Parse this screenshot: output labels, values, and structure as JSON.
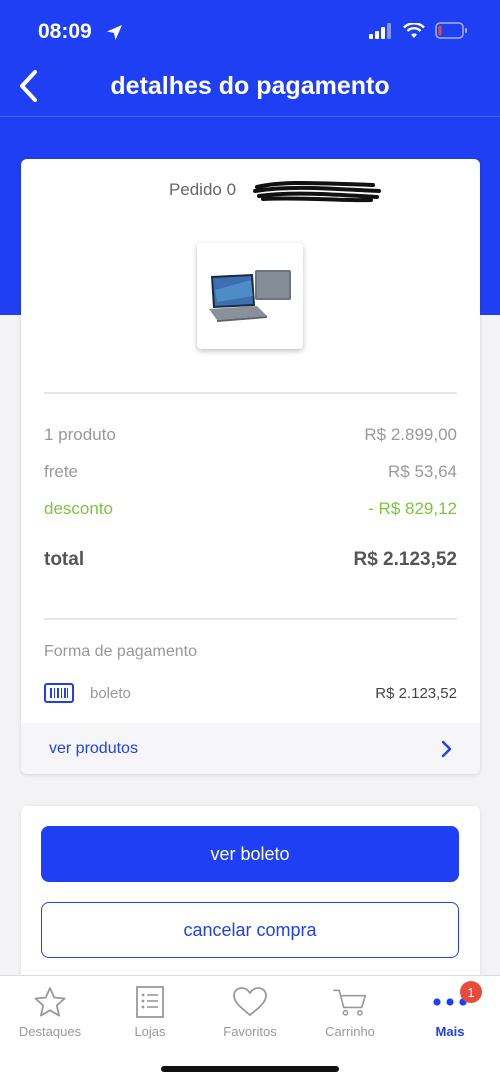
{
  "status_bar": {
    "time": "08:09"
  },
  "header": {
    "title": "detalhes do pagamento"
  },
  "order": {
    "id_label": "Pedido 0",
    "product_image": "laptop-product-image",
    "rows": {
      "products_label": "1 produto",
      "products_value": "R$ 2.899,00",
      "shipping_label": "frete",
      "shipping_value": "R$ 53,64",
      "discount_label": "desconto",
      "discount_value": "- R$ 829,12",
      "total_label": "total",
      "total_value": "R$ 2.123,52"
    },
    "payment": {
      "label": "Forma de pagamento",
      "method": "boleto",
      "method_icon": "barcode-icon",
      "amount": "R$ 2.123,52"
    },
    "see_products": "ver produtos"
  },
  "actions": {
    "view_boleto": "ver boleto",
    "cancel_purchase": "cancelar compra"
  },
  "tab_bar": {
    "tabs": [
      {
        "label": "Destaques",
        "icon": "star-icon"
      },
      {
        "label": "Lojas",
        "icon": "list-icon"
      },
      {
        "label": "Favoritos",
        "icon": "heart-icon"
      },
      {
        "label": "Carrinho",
        "icon": "cart-icon"
      },
      {
        "label": "Mais",
        "icon": "more-dots-icon",
        "active": true,
        "badge": "1"
      }
    ]
  },
  "colors": {
    "brand_blue": "#1f3ff5",
    "discount_green": "#7cc63a",
    "badge_red": "#e84b3c"
  }
}
